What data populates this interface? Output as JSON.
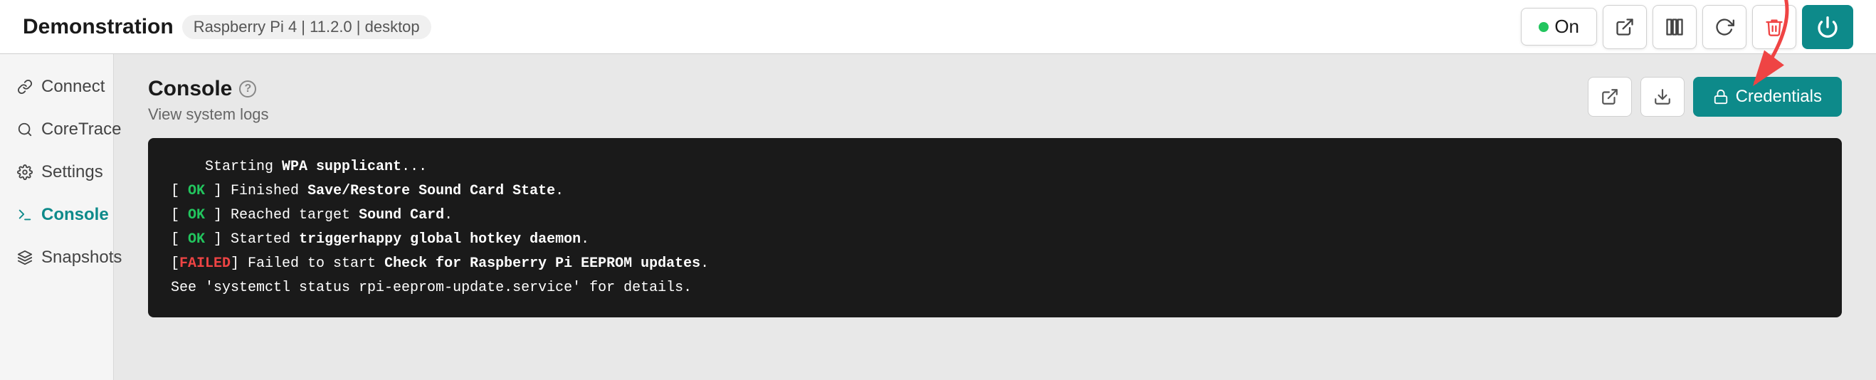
{
  "header": {
    "title": "Demonstration",
    "meta": "Raspberry Pi 4 | 11.2.0 | desktop",
    "status_label": "On",
    "status_color": "#22c55e"
  },
  "toolbar": {
    "open_external_label": "open-external",
    "columns_label": "columns",
    "refresh_label": "refresh",
    "delete_label": "delete",
    "power_label": "power"
  },
  "sidebar": {
    "items": [
      {
        "id": "connect",
        "label": "Connect",
        "icon": "link"
      },
      {
        "id": "coretrace",
        "label": "CoreTrace",
        "icon": "search"
      },
      {
        "id": "settings",
        "label": "Settings",
        "icon": "settings"
      },
      {
        "id": "console",
        "label": "Console",
        "icon": "terminal",
        "active": true
      },
      {
        "id": "snapshots",
        "label": "Snapshots",
        "icon": "layers"
      }
    ]
  },
  "console": {
    "title": "Console",
    "subtitle": "View system logs",
    "credentials_label": "Credentials",
    "terminal_lines": [
      {
        "type": "plain",
        "text": "    Starting WPA supplicant..."
      },
      {
        "type": "ok",
        "prefix": "[",
        "badge": " OK ",
        "suffix": "] Finished ",
        "bold_text": "Save/Restore Sound Card State",
        "end": "."
      },
      {
        "type": "ok",
        "prefix": "[",
        "badge": " OK ",
        "suffix": "] Reached target ",
        "bold_text": "Sound Card",
        "end": "."
      },
      {
        "type": "ok",
        "prefix": "[",
        "badge": " OK ",
        "suffix": "] Started ",
        "bold_text": "triggerhappy global hotkey daemon",
        "end": "."
      },
      {
        "type": "failed",
        "prefix": "[",
        "badge": "FAILED",
        "suffix": "] Failed to start ",
        "bold_text": "Check for Raspberry Pi EEPROM updates",
        "end": "."
      },
      {
        "type": "plain",
        "text": "See 'systemctl status rpi-eeprom-update.service' for details."
      }
    ]
  },
  "arrow": {
    "visible": true,
    "color": "#ef4444"
  }
}
